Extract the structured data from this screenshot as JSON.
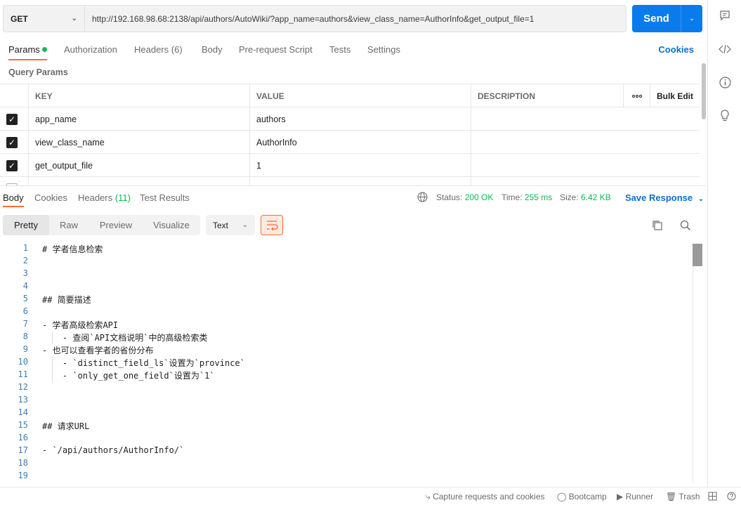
{
  "request": {
    "method": "GET",
    "url": "http://192.168.98.68:2138/api/authors/AutoWiki/?app_name=authors&view_class_name=AuthorInfo&get_output_file=1",
    "send_label": "Send"
  },
  "request_tabs": [
    {
      "label": "Params",
      "count": ""
    },
    {
      "label": "Authorization",
      "count": ""
    },
    {
      "label": "Headers",
      "count": "(6)"
    },
    {
      "label": "Body",
      "count": ""
    },
    {
      "label": "Pre-request Script",
      "count": ""
    },
    {
      "label": "Tests",
      "count": ""
    },
    {
      "label": "Settings",
      "count": ""
    }
  ],
  "cookies_label": "Cookies",
  "query_params_title": "Query Params",
  "params_table": {
    "headers": {
      "key": "KEY",
      "value": "VALUE",
      "description": "DESCRIPTION",
      "more": "ooo",
      "bulk_edit": "Bulk Edit"
    },
    "rows": [
      {
        "checked": true,
        "key": "app_name",
        "value": "authors",
        "description": ""
      },
      {
        "checked": true,
        "key": "view_class_name",
        "value": "AuthorInfo",
        "description": ""
      },
      {
        "checked": true,
        "key": "get_output_file",
        "value": "1",
        "description": ""
      },
      {
        "checked": false,
        "key": "",
        "value": "",
        "description": ""
      }
    ]
  },
  "response_tabs": [
    {
      "label": "Body",
      "count": ""
    },
    {
      "label": "Cookies",
      "count": ""
    },
    {
      "label": "Headers",
      "count": "(11)"
    },
    {
      "label": "Test Results",
      "count": ""
    }
  ],
  "response_meta": {
    "status_label": "Status:",
    "status": "200 OK",
    "time_label": "Time:",
    "time": "255 ms",
    "size_label": "Size:",
    "size": "6.42 KB",
    "save_label": "Save Response"
  },
  "view_modes": [
    "Pretty",
    "Raw",
    "Preview",
    "Visualize"
  ],
  "format": "Text",
  "code_lines": [
    {
      "n": "1",
      "t": "# 学者信息检索"
    },
    {
      "n": "2",
      "t": ""
    },
    {
      "n": "3",
      "t": ""
    },
    {
      "n": "4",
      "t": ""
    },
    {
      "n": "5",
      "t": "## 简要描述"
    },
    {
      "n": "6",
      "t": ""
    },
    {
      "n": "7",
      "t": "- 学者高级检索API"
    },
    {
      "n": "8",
      "t": "    - 查阅`API文档说明`中的高级检索类"
    },
    {
      "n": "9",
      "t": "- 也可以查看学者的省份分布"
    },
    {
      "n": "10",
      "t": "    - `distinct_field_ls`设置为`province`"
    },
    {
      "n": "11",
      "t": "    - `only_get_one_field`设置为`1`"
    },
    {
      "n": "12",
      "t": ""
    },
    {
      "n": "13",
      "t": ""
    },
    {
      "n": "14",
      "t": ""
    },
    {
      "n": "15",
      "t": "## 请求URL"
    },
    {
      "n": "16",
      "t": ""
    },
    {
      "n": "17",
      "t": "- `/api/authors/AuthorInfo/`"
    },
    {
      "n": "18",
      "t": ""
    },
    {
      "n": "19",
      "t": ""
    }
  ],
  "footer": {
    "capture": "Capture requests and cookies",
    "bootcamp": "Bootcamp",
    "runner": "Runner",
    "trash": "Trash"
  },
  "colors": {
    "accent": "#ff6c37",
    "send": "#097bed",
    "link": "#0b6fd1",
    "success": "#0cbb52"
  }
}
